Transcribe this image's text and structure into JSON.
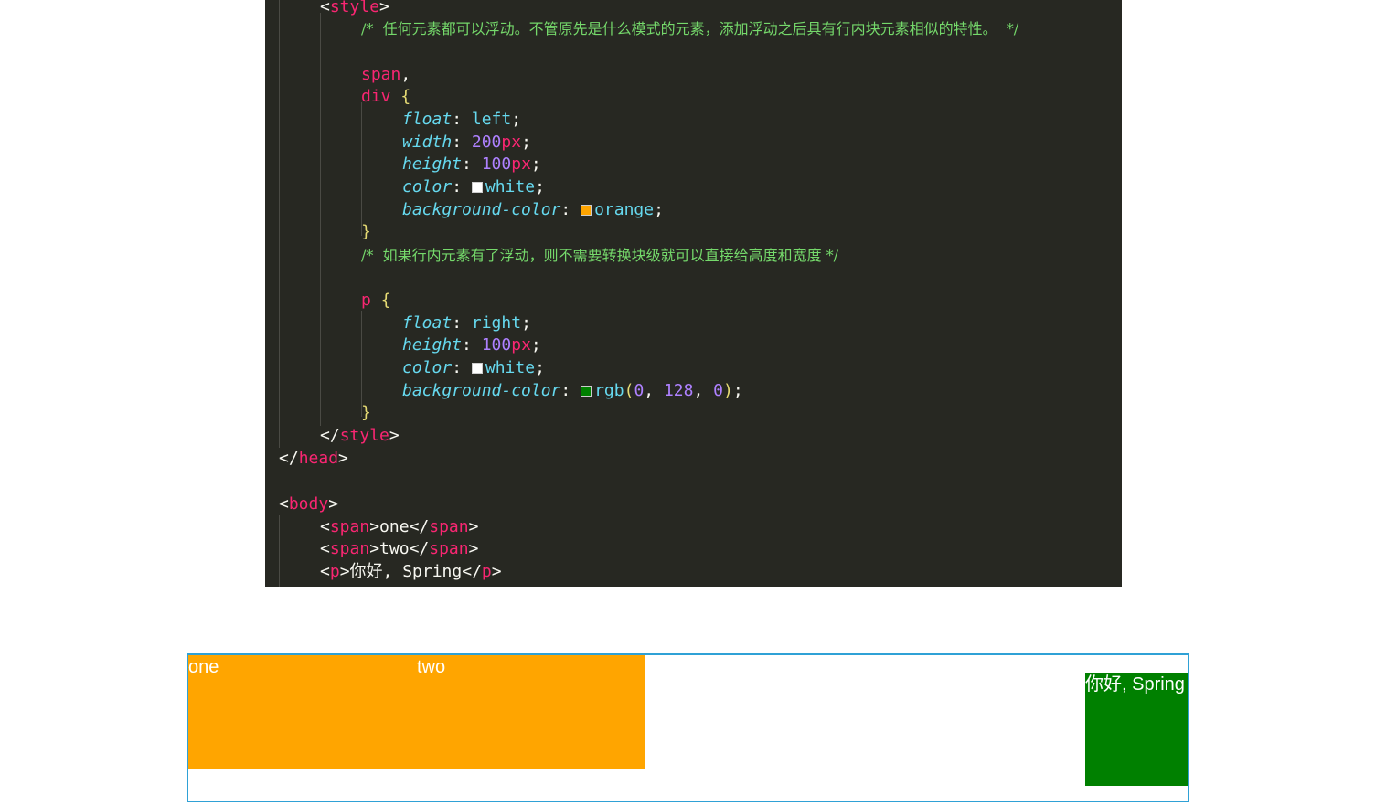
{
  "colors": {
    "editor_bg": "#272822",
    "orange": "#ffa500",
    "green": "#008000",
    "demo_border": "#2fa1d6"
  },
  "code": {
    "open_style": "style",
    "comment1": "/*  任何元素都可以浮动。不管原先是什么模式的元素，添加浮动之后具有行内块元素相似的特性。  */",
    "sel_span": "span",
    "sel_div": "div",
    "prop_float": "float",
    "val_left": "left",
    "prop_width": "width",
    "num_200": "200",
    "unit_px": "px",
    "prop_height": "height",
    "num_100": "100",
    "prop_color": "color",
    "val_white": "white",
    "prop_bg": "background-color",
    "val_orange": "orange",
    "comment2": "/*  如果行内元素有了浮动，则不需要转换块级就可以直接给高度和宽度 */",
    "sel_p": "p",
    "val_right": "right",
    "val_rgb": "rgb",
    "num_0": "0",
    "num_128": "128",
    "close_style": "style",
    "close_head": "head",
    "open_body": "body",
    "tag_span": "span",
    "text_one": "one",
    "text_two": "two",
    "tag_p": "p",
    "text_p": "你好, Spring"
  },
  "demo": {
    "span1": "one",
    "span2": "two",
    "p": "你好, Spring"
  }
}
